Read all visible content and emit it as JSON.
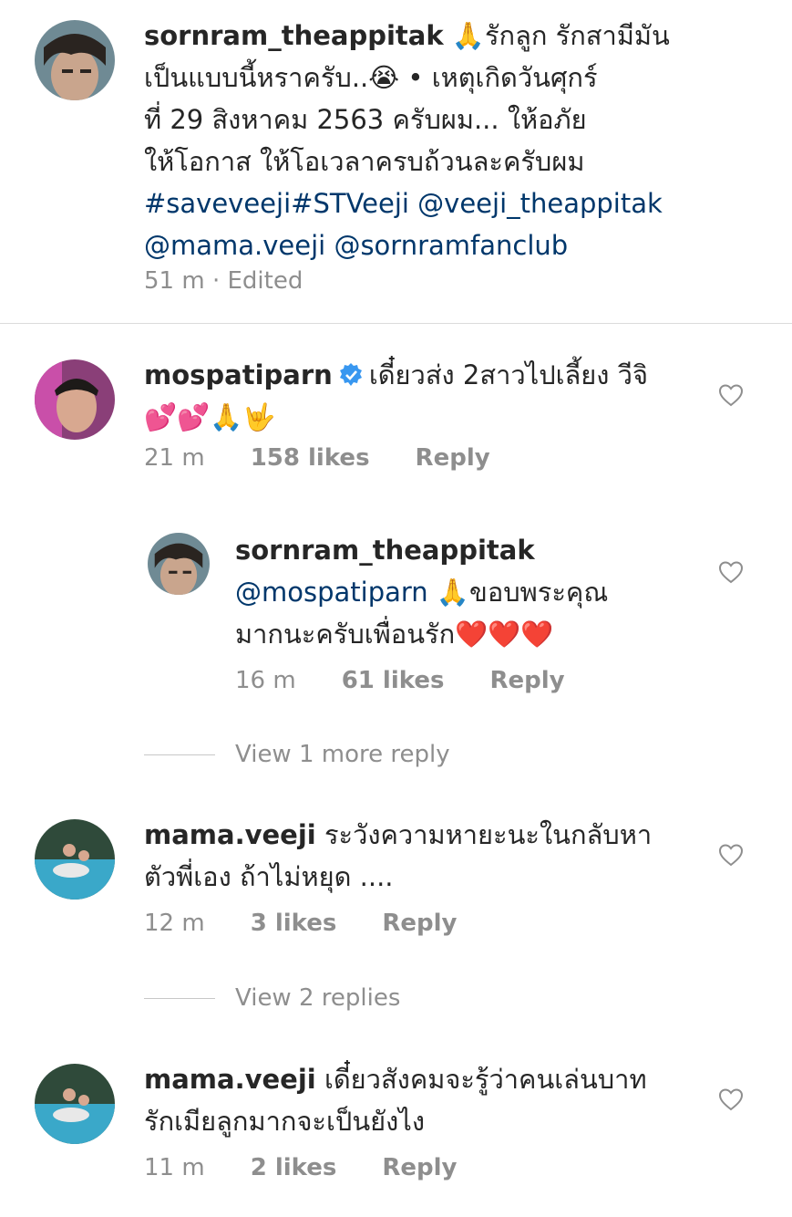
{
  "caption": {
    "username": "sornram_theappitak",
    "text_line1": "🙏รักลูก รักสามีมัน",
    "text_line2": "เป็นแบบนี้หราครับ..😭 • เหตุเกิดวันศุกร์",
    "text_line3": "ที่ 29 สิงหาคม 2563  ครับผม... ให้อภัย",
    "text_line4": "ให้โอกาส ให้โอเวลาครบถ้วนละครับผม",
    "hashtags": "#saveveeji#STVeeji @veeji_theappitak",
    "mentions": "@mama.veeji @sornramfanclub",
    "time": "51 m",
    "edited": "· Edited"
  },
  "comments": [
    {
      "username": "mospatiparn",
      "verified": true,
      "text_line1": "เดี๋ยวส่ง 2สาวไปเลี้ยง วีจิ",
      "text_line2": "💕💕🙏🤟",
      "time": "21 m",
      "likes": "158 likes",
      "reply": "Reply"
    },
    {
      "username": "sornram_theappitak",
      "mention": "@mospatiparn",
      "text_line1": "🙏ขอบพระคุณ",
      "text_line2": "มากนะครับเพื่อนรัก❤️❤️❤️",
      "time": "16 m",
      "likes": "61 likes",
      "reply": "Reply",
      "view_more": "View 1 more reply"
    },
    {
      "username": "mama.veeji",
      "text_line1": "ระวังความหายะนะในกลับหา",
      "text_line2": "ตัวพี่เอง ถ้าไม่หยุด ....",
      "time": "12 m",
      "likes": "3 likes",
      "reply": "Reply",
      "view_more": "View 2 replies"
    },
    {
      "username": "mama.veeji",
      "text_line1": "เดี๋ยวสังคมจะรู้ว่าคนเล่นบาท",
      "text_line2": "รักเมียลูกมากจะเป็นยังไง",
      "time": "11 m",
      "likes": "2 likes",
      "reply": "Reply"
    }
  ],
  "colors": {
    "link": "#00376b",
    "secondary": "#8e8e8e",
    "verified": "#3897f0"
  },
  "icons": [
    "heart-outline-icon",
    "verified-badge-icon"
  ]
}
